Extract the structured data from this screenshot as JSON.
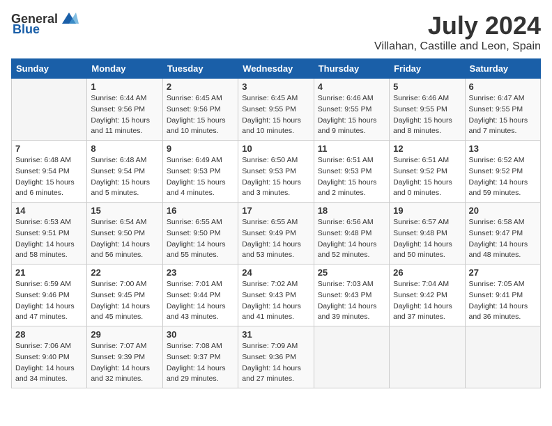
{
  "header": {
    "logo": {
      "general": "General",
      "blue": "Blue"
    },
    "title": "July 2024",
    "subtitle": "Villahan, Castille and Leon, Spain"
  },
  "weekdays": [
    "Sunday",
    "Monday",
    "Tuesday",
    "Wednesday",
    "Thursday",
    "Friday",
    "Saturday"
  ],
  "weeks": [
    [
      {
        "day": "",
        "sunrise": "",
        "sunset": "",
        "daylight": ""
      },
      {
        "day": "1",
        "sunrise": "Sunrise: 6:44 AM",
        "sunset": "Sunset: 9:56 PM",
        "daylight": "Daylight: 15 hours and 11 minutes."
      },
      {
        "day": "2",
        "sunrise": "Sunrise: 6:45 AM",
        "sunset": "Sunset: 9:56 PM",
        "daylight": "Daylight: 15 hours and 10 minutes."
      },
      {
        "day": "3",
        "sunrise": "Sunrise: 6:45 AM",
        "sunset": "Sunset: 9:55 PM",
        "daylight": "Daylight: 15 hours and 10 minutes."
      },
      {
        "day": "4",
        "sunrise": "Sunrise: 6:46 AM",
        "sunset": "Sunset: 9:55 PM",
        "daylight": "Daylight: 15 hours and 9 minutes."
      },
      {
        "day": "5",
        "sunrise": "Sunrise: 6:46 AM",
        "sunset": "Sunset: 9:55 PM",
        "daylight": "Daylight: 15 hours and 8 minutes."
      },
      {
        "day": "6",
        "sunrise": "Sunrise: 6:47 AM",
        "sunset": "Sunset: 9:55 PM",
        "daylight": "Daylight: 15 hours and 7 minutes."
      }
    ],
    [
      {
        "day": "7",
        "sunrise": "Sunrise: 6:48 AM",
        "sunset": "Sunset: 9:54 PM",
        "daylight": "Daylight: 15 hours and 6 minutes."
      },
      {
        "day": "8",
        "sunrise": "Sunrise: 6:48 AM",
        "sunset": "Sunset: 9:54 PM",
        "daylight": "Daylight: 15 hours and 5 minutes."
      },
      {
        "day": "9",
        "sunrise": "Sunrise: 6:49 AM",
        "sunset": "Sunset: 9:53 PM",
        "daylight": "Daylight: 15 hours and 4 minutes."
      },
      {
        "day": "10",
        "sunrise": "Sunrise: 6:50 AM",
        "sunset": "Sunset: 9:53 PM",
        "daylight": "Daylight: 15 hours and 3 minutes."
      },
      {
        "day": "11",
        "sunrise": "Sunrise: 6:51 AM",
        "sunset": "Sunset: 9:53 PM",
        "daylight": "Daylight: 15 hours and 2 minutes."
      },
      {
        "day": "12",
        "sunrise": "Sunrise: 6:51 AM",
        "sunset": "Sunset: 9:52 PM",
        "daylight": "Daylight: 15 hours and 0 minutes."
      },
      {
        "day": "13",
        "sunrise": "Sunrise: 6:52 AM",
        "sunset": "Sunset: 9:52 PM",
        "daylight": "Daylight: 14 hours and 59 minutes."
      }
    ],
    [
      {
        "day": "14",
        "sunrise": "Sunrise: 6:53 AM",
        "sunset": "Sunset: 9:51 PM",
        "daylight": "Daylight: 14 hours and 58 minutes."
      },
      {
        "day": "15",
        "sunrise": "Sunrise: 6:54 AM",
        "sunset": "Sunset: 9:50 PM",
        "daylight": "Daylight: 14 hours and 56 minutes."
      },
      {
        "day": "16",
        "sunrise": "Sunrise: 6:55 AM",
        "sunset": "Sunset: 9:50 PM",
        "daylight": "Daylight: 14 hours and 55 minutes."
      },
      {
        "day": "17",
        "sunrise": "Sunrise: 6:55 AM",
        "sunset": "Sunset: 9:49 PM",
        "daylight": "Daylight: 14 hours and 53 minutes."
      },
      {
        "day": "18",
        "sunrise": "Sunrise: 6:56 AM",
        "sunset": "Sunset: 9:48 PM",
        "daylight": "Daylight: 14 hours and 52 minutes."
      },
      {
        "day": "19",
        "sunrise": "Sunrise: 6:57 AM",
        "sunset": "Sunset: 9:48 PM",
        "daylight": "Daylight: 14 hours and 50 minutes."
      },
      {
        "day": "20",
        "sunrise": "Sunrise: 6:58 AM",
        "sunset": "Sunset: 9:47 PM",
        "daylight": "Daylight: 14 hours and 48 minutes."
      }
    ],
    [
      {
        "day": "21",
        "sunrise": "Sunrise: 6:59 AM",
        "sunset": "Sunset: 9:46 PM",
        "daylight": "Daylight: 14 hours and 47 minutes."
      },
      {
        "day": "22",
        "sunrise": "Sunrise: 7:00 AM",
        "sunset": "Sunset: 9:45 PM",
        "daylight": "Daylight: 14 hours and 45 minutes."
      },
      {
        "day": "23",
        "sunrise": "Sunrise: 7:01 AM",
        "sunset": "Sunset: 9:44 PM",
        "daylight": "Daylight: 14 hours and 43 minutes."
      },
      {
        "day": "24",
        "sunrise": "Sunrise: 7:02 AM",
        "sunset": "Sunset: 9:43 PM",
        "daylight": "Daylight: 14 hours and 41 minutes."
      },
      {
        "day": "25",
        "sunrise": "Sunrise: 7:03 AM",
        "sunset": "Sunset: 9:43 PM",
        "daylight": "Daylight: 14 hours and 39 minutes."
      },
      {
        "day": "26",
        "sunrise": "Sunrise: 7:04 AM",
        "sunset": "Sunset: 9:42 PM",
        "daylight": "Daylight: 14 hours and 37 minutes."
      },
      {
        "day": "27",
        "sunrise": "Sunrise: 7:05 AM",
        "sunset": "Sunset: 9:41 PM",
        "daylight": "Daylight: 14 hours and 36 minutes."
      }
    ],
    [
      {
        "day": "28",
        "sunrise": "Sunrise: 7:06 AM",
        "sunset": "Sunset: 9:40 PM",
        "daylight": "Daylight: 14 hours and 34 minutes."
      },
      {
        "day": "29",
        "sunrise": "Sunrise: 7:07 AM",
        "sunset": "Sunset: 9:39 PM",
        "daylight": "Daylight: 14 hours and 32 minutes."
      },
      {
        "day": "30",
        "sunrise": "Sunrise: 7:08 AM",
        "sunset": "Sunset: 9:37 PM",
        "daylight": "Daylight: 14 hours and 29 minutes."
      },
      {
        "day": "31",
        "sunrise": "Sunrise: 7:09 AM",
        "sunset": "Sunset: 9:36 PM",
        "daylight": "Daylight: 14 hours and 27 minutes."
      },
      {
        "day": "",
        "sunrise": "",
        "sunset": "",
        "daylight": ""
      },
      {
        "day": "",
        "sunrise": "",
        "sunset": "",
        "daylight": ""
      },
      {
        "day": "",
        "sunrise": "",
        "sunset": "",
        "daylight": ""
      }
    ]
  ]
}
